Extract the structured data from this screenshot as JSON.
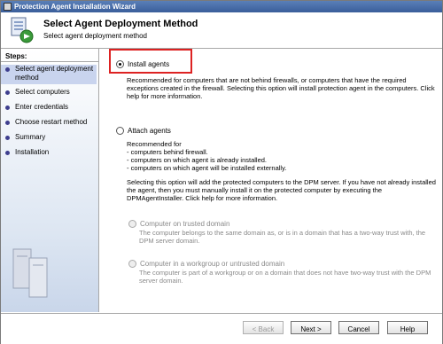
{
  "window": {
    "title": "Protection Agent Installation Wizard"
  },
  "header": {
    "title": "Select Agent Deployment Method",
    "subtitle": "Select agent deployment method"
  },
  "sidebar": {
    "steps_label": "Steps:",
    "items": [
      {
        "label": "Select agent deployment method",
        "active": true
      },
      {
        "label": "Select computers"
      },
      {
        "label": "Enter credentials"
      },
      {
        "label": "Choose restart method"
      },
      {
        "label": "Summary"
      },
      {
        "label": "Installation"
      }
    ]
  },
  "options": {
    "install": {
      "label": "Install agents",
      "selected": true,
      "description": "Recommended for computers that are not behind firewalls, or computers that have the required exceptions created in the firewall. Selecting this option will install protection agent in the computers. Click help for more information."
    },
    "attach": {
      "label": "Attach agents",
      "selected": false,
      "rec_header": "Recommended for",
      "rec_items": [
        "- computers behind firewall.",
        "- computers on which agent is already installed.",
        "- computers on which agent will be installed externally."
      ],
      "description": "Selecting this option will add the protected computers to the DPM server. If you have not already installed the agent, then you must manually install it on the protected computer by executing the DPMAgentInstaller. Click help for more information."
    },
    "trusted": {
      "label": "Computer on trusted domain",
      "description": "The computer belongs to the same domain as, or is in a domain that has a two-way trust with, the DPM server domain."
    },
    "untrusted": {
      "label": "Computer in a workgroup or untrusted domain",
      "description": "The computer is part of a workgroup or on a domain that does not have two-way trust with the DPM server domain."
    }
  },
  "buttons": {
    "back": "< Back",
    "next": "Next >",
    "cancel": "Cancel",
    "help": "Help"
  },
  "colors": {
    "titlebar": "#3a5e9a",
    "highlight_box": "#dd2222",
    "active_step": "#c9d4ee"
  }
}
